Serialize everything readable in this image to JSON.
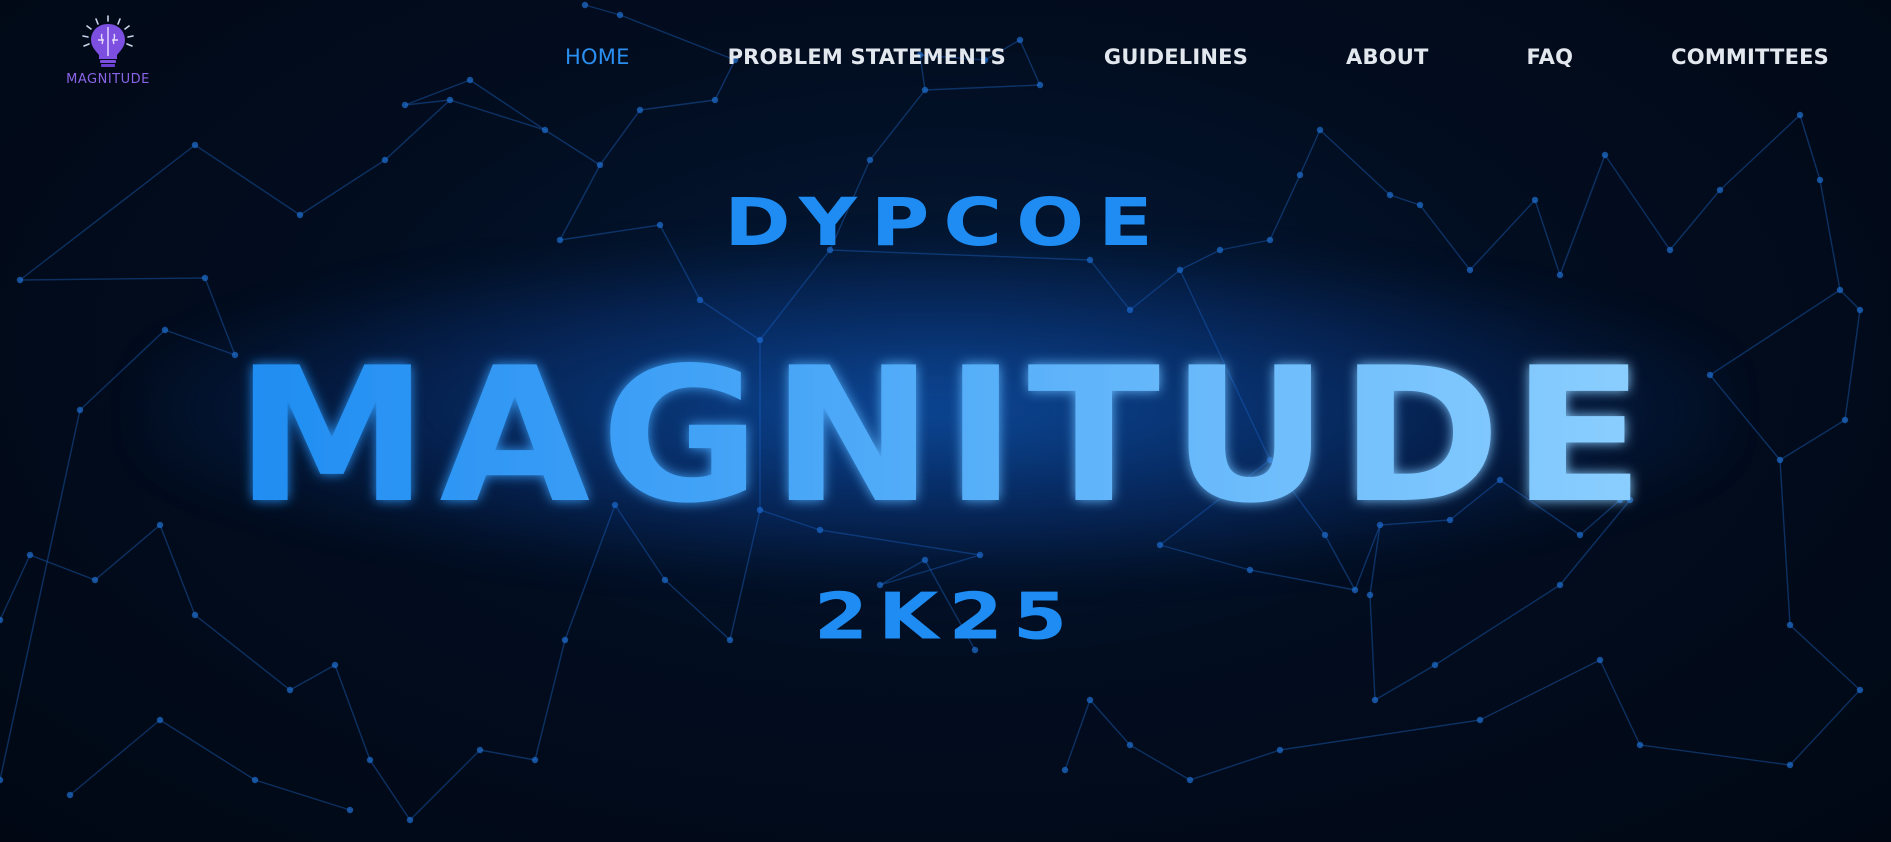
{
  "brand": {
    "name": "MAGNITUDE",
    "accent_color": "#8a63e6",
    "icon": "lightbulb-brain-icon"
  },
  "nav": {
    "items": [
      {
        "label": "HOME",
        "active": true
      },
      {
        "label": "PROBLEM STATEMENTS",
        "active": false
      },
      {
        "label": "GUIDELINES",
        "active": false
      },
      {
        "label": "ABOUT",
        "active": false
      },
      {
        "label": "FAQ",
        "active": false
      },
      {
        "label": "COMMITTEES",
        "active": false
      }
    ],
    "active_color": "#2a8ff0",
    "text_color": "#e3e8ef"
  },
  "hero": {
    "pre_title": "DYPCOE",
    "title": "MAGNITUDE",
    "post_title": "2K25",
    "title_gradient": [
      "#1e8cf2",
      "#8ccfff"
    ],
    "background_color": "#020b1c",
    "background_pattern": "network-lines"
  }
}
